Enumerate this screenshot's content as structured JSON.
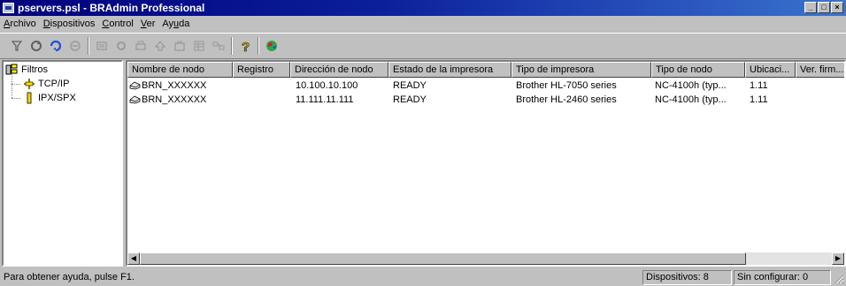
{
  "window": {
    "title": "pservers.psl - BRAdmin Professional",
    "buttons": [
      "_",
      "□",
      "×"
    ]
  },
  "menu": [
    {
      "pre": "",
      "u": "A",
      "post": "rchivo"
    },
    {
      "pre": "",
      "u": "D",
      "post": "ispositivos"
    },
    {
      "pre": "",
      "u": "C",
      "post": "ontrol"
    },
    {
      "pre": "",
      "u": "V",
      "post": "er"
    },
    {
      "pre": "Ay",
      "u": "u",
      "post": "da"
    }
  ],
  "toolbar": {
    "icons": [
      "filter-icon",
      "refresh-icon",
      "search-icon",
      "device-icon",
      "configure-icon",
      "settings-icon",
      "printer-status-icon",
      "upgrade-icon",
      "properties-icon",
      "grid-icon",
      "network-icon",
      "help-icon",
      "web-icon"
    ]
  },
  "tree": {
    "root": "Filtros",
    "children": [
      "TCP/IP",
      "IPX/SPX"
    ]
  },
  "table": {
    "columns": [
      "Nombre de nodo",
      "Registro",
      "Dirección de nodo",
      "Estado de la impresora",
      "Tipo de impresora",
      "Tipo de nodo",
      "Ubicaci...",
      "Ver. firm..."
    ],
    "rows": [
      [
        "BRN_XXXXXX",
        "",
        "10.100.10.100",
        "READY",
        "Brother HL-7050 series",
        "NC-4100h (typ...",
        "1.11",
        ""
      ],
      [
        "BRN_XXXXXX",
        "",
        "11.111.11.111",
        "READY",
        "Brother HL-2460 series",
        "NC-4100h (typ...",
        "1.11",
        ""
      ]
    ]
  },
  "status": {
    "help": "Para obtener ayuda, pulse F1.",
    "devices": "Dispositivos: 8",
    "unconfigured": "Sin configurar: 0"
  }
}
